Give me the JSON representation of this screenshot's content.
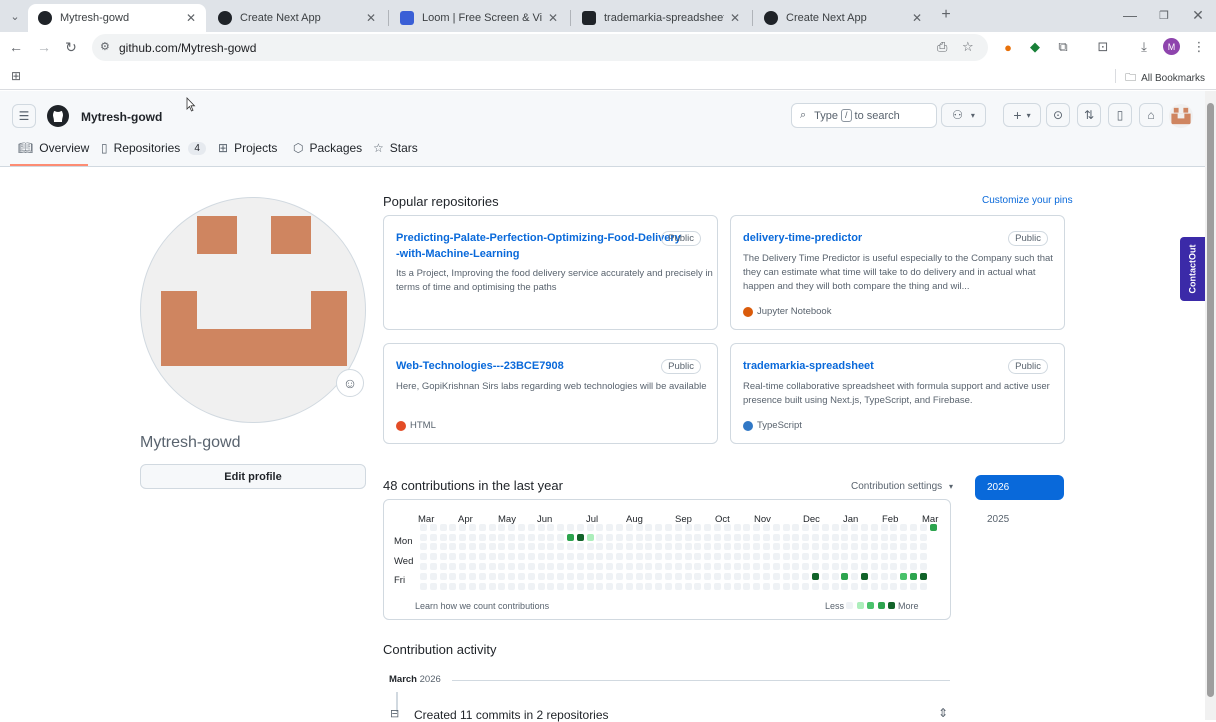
{
  "browser": {
    "tabs": [
      {
        "title": "Mytresh-gowd",
        "active": true
      },
      {
        "title": "Create Next App",
        "active": false
      },
      {
        "title": "Loom | Free Screen & Video Re",
        "active": false
      },
      {
        "title": "trademarkia-spreadsheet · We",
        "active": false
      },
      {
        "title": "Create Next App",
        "active": false
      }
    ],
    "url": "github.com/Mytresh-gowd",
    "profile_initial": "M",
    "all_bookmarks": "All Bookmarks"
  },
  "header": {
    "username": "Mytresh-gowd",
    "search_prefix": "Type",
    "search_slash": "/",
    "search_suffix": "to search"
  },
  "nav": {
    "overview": "Overview",
    "repositories": "Repositories",
    "repositories_count": "4",
    "projects": "Projects",
    "packages": "Packages",
    "stars": "Stars"
  },
  "profile": {
    "display_name": "Mytresh-gowd",
    "edit_label": "Edit profile"
  },
  "popular": {
    "title": "Popular repositories",
    "customize": "Customize your pins",
    "repos": [
      {
        "name": "Predicting-Palate-Perfection-Optimizing-Food-Delivery-with-Machine-Learning",
        "name_l1": "Predicting-Palate-Perfection-Optimizing-Food-Delivery",
        "name_l2": "-with-Machine-Learning",
        "badge": "Public",
        "desc_l1": "Its a Project, Improving the food delivery service accurately and precisely in",
        "desc_l2": "terms of time and optimising the paths",
        "desc_l3": "",
        "lang": "",
        "lang_color": ""
      },
      {
        "name": "delivery-time-predictor",
        "name_l1": "delivery-time-predictor",
        "name_l2": "",
        "badge": "Public",
        "desc_l1": "The Delivery Time Predictor is useful especially to the Company such that",
        "desc_l2": "they can estimate what time will take to do delivery and in actual what",
        "desc_l3": "happen and they will both compare the thing and wil...",
        "lang": "Jupyter Notebook",
        "lang_color": "#DA5B0B"
      },
      {
        "name": "Web-Technologies---23BCE7908",
        "name_l1": "Web-Technologies---23BCE7908",
        "name_l2": "",
        "badge": "Public",
        "desc_l1": "Here, GopiKrishnan Sirs labs regarding web technologies will be available",
        "desc_l2": "",
        "desc_l3": "",
        "lang": "HTML",
        "lang_color": "#e34c26"
      },
      {
        "name": "trademarkia-spreadsheet",
        "name_l1": "trademarkia-spreadsheet",
        "name_l2": "",
        "badge": "Public",
        "desc_l1": "Real-time collaborative spreadsheet with formula support and active user",
        "desc_l2": "presence built using Next.js, TypeScript, and Firebase.",
        "desc_l3": "",
        "lang": "TypeScript",
        "lang_color": "#3178c6"
      }
    ]
  },
  "contributions": {
    "title": "48 contributions in the last year",
    "settings": "Contribution settings",
    "months": [
      "Mar",
      "Apr",
      "May",
      "Jun",
      "Jul",
      "Aug",
      "Sep",
      "Oct",
      "Nov",
      "Dec",
      "Jan",
      "Feb",
      "Mar"
    ],
    "days": [
      "Mon",
      "Wed",
      "Fri"
    ],
    "learn": "Learn how we count contributions",
    "less": "Less",
    "more": "More",
    "years": [
      "2026",
      "2025"
    ],
    "levels": [
      "#eff2f5",
      "#aceebb",
      "#4ac26b",
      "#2da44e",
      "#116329"
    ]
  },
  "activity": {
    "title": "Contribution activity",
    "month": "March",
    "year": "2026",
    "item": "Created 11 commits in 2 repositories"
  },
  "extension": {
    "contactout": "ContactOut"
  }
}
